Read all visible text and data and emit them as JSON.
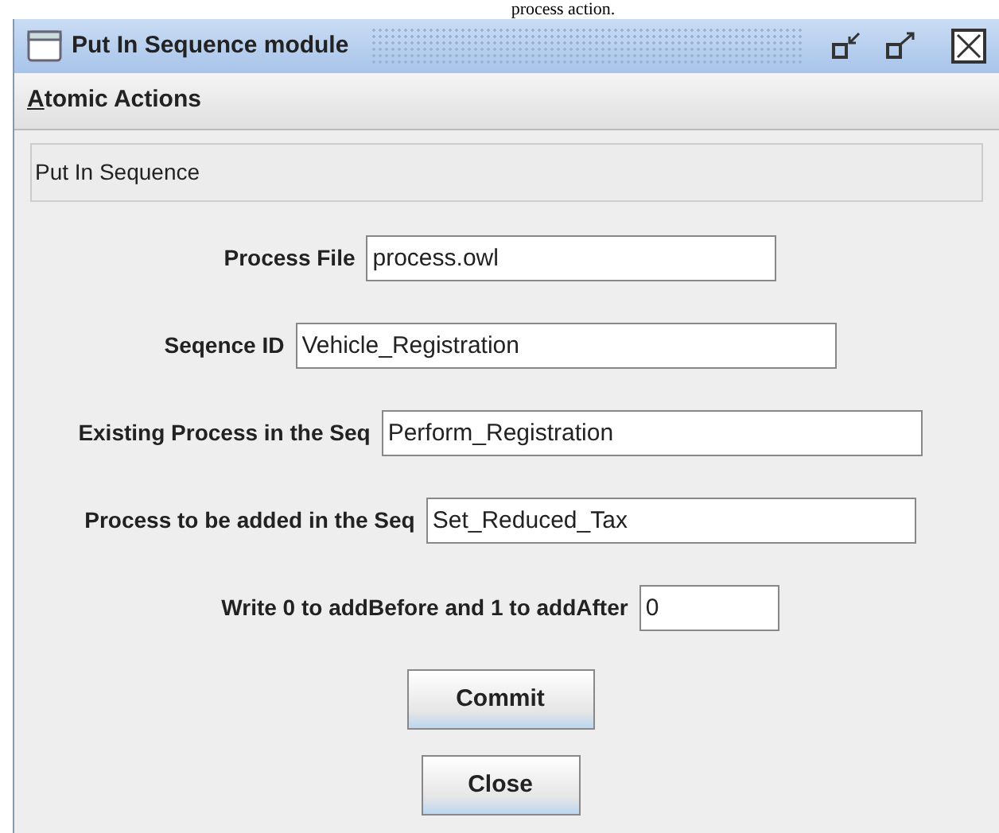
{
  "caption": "process action.",
  "window": {
    "title": "Put In Sequence module"
  },
  "menu": [
    {
      "label": "Atomic Actions"
    }
  ],
  "panel_title": "Put In Sequence",
  "fields": [
    {
      "label": "Process File",
      "value": "process.owl"
    },
    {
      "label": "Seqence ID",
      "value": "Vehicle_Registration"
    },
    {
      "label": "Existing Process in the Seq",
      "value": "Perform_Registration"
    },
    {
      "label": "Process to be added in the Seq",
      "value": "Set_Reduced_Tax"
    },
    {
      "label": "Write 0 to addBefore and 1 to addAfter",
      "value": "0"
    }
  ],
  "buttons": [
    "Commit",
    "Close"
  ]
}
